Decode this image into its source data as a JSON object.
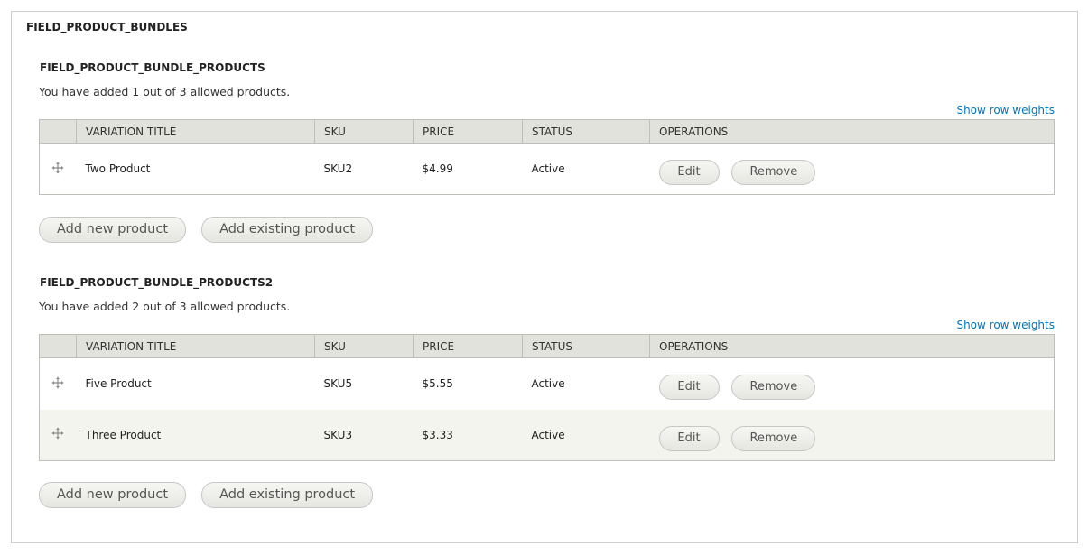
{
  "fieldset": {
    "legend": "FIELD_PRODUCT_BUNDLES"
  },
  "sections": [
    {
      "title": "FIELD_PRODUCT_BUNDLE_PRODUCTS",
      "description": "You have added 1 out of 3 allowed products.",
      "row_weights_link": "Show row weights",
      "columns": [
        "VARIATION TITLE",
        "SKU",
        "PRICE",
        "STATUS",
        "OPERATIONS"
      ],
      "rows": [
        {
          "title": "Two Product",
          "sku": "SKU2",
          "price": "$4.99",
          "status": "Active",
          "edit": "Edit",
          "remove": "Remove"
        }
      ],
      "add_new_label": "Add new product",
      "add_existing_label": "Add existing product"
    },
    {
      "title": "FIELD_PRODUCT_BUNDLE_PRODUCTS2",
      "description": "You have added 2 out of 3 allowed products.",
      "row_weights_link": "Show row weights",
      "columns": [
        "VARIATION TITLE",
        "SKU",
        "PRICE",
        "STATUS",
        "OPERATIONS"
      ],
      "rows": [
        {
          "title": "Five Product",
          "sku": "SKU5",
          "price": "$5.55",
          "status": "Active",
          "edit": "Edit",
          "remove": "Remove"
        },
        {
          "title": "Three Product",
          "sku": "SKU3",
          "price": "$3.33",
          "status": "Active",
          "edit": "Edit",
          "remove": "Remove"
        }
      ],
      "add_new_label": "Add new product",
      "add_existing_label": "Add existing product"
    }
  ],
  "colors": {
    "link": "#0074bd",
    "header_bg": "#e1e2dc",
    "even_row_bg": "#f3f4ee",
    "border": "#bfbfba"
  },
  "icons": {
    "drag_handle": "move-handle-icon"
  }
}
